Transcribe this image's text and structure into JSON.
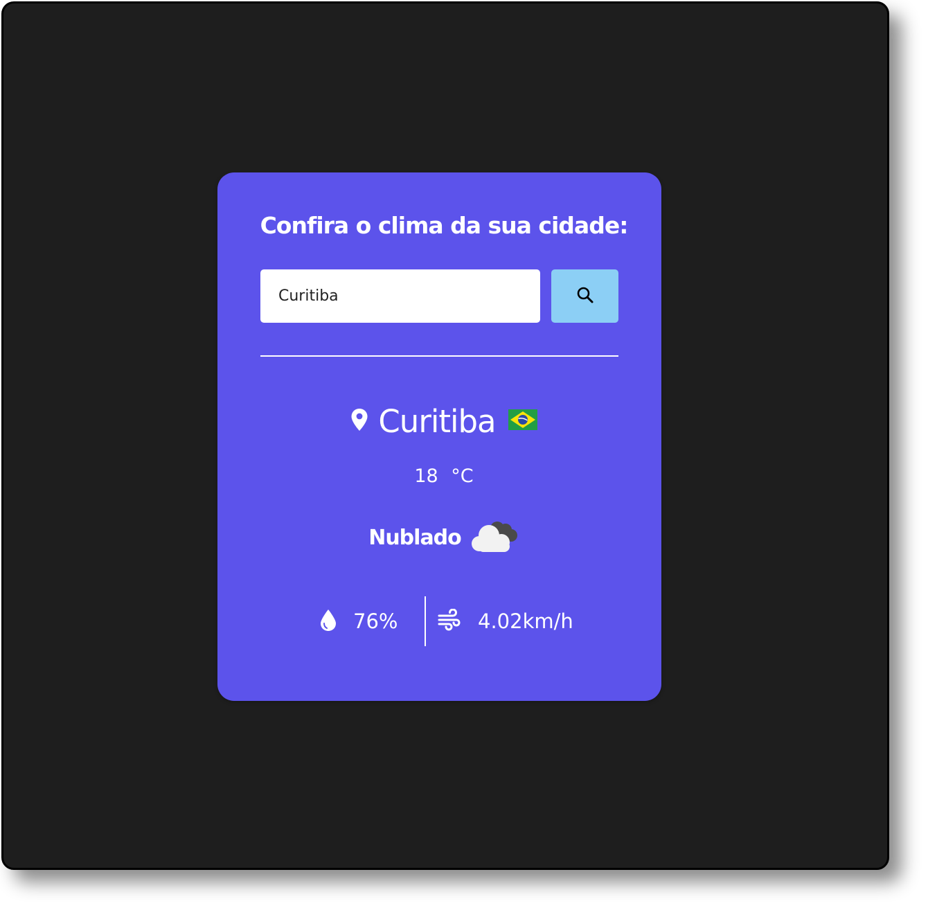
{
  "header": {
    "title": "Confira o clima da sua cidade:"
  },
  "search": {
    "value": "Curitiba",
    "button_icon": "search-icon"
  },
  "weather": {
    "city": "Curitiba",
    "country_flag": "brazil-flag-icon",
    "temperature": "18",
    "unit": "°C",
    "condition": "Nublado",
    "condition_icon": "cloudy-icon",
    "humidity": "76%",
    "wind": "4.02km/h"
  },
  "colors": {
    "background": "#1e1e1e",
    "card": "#5c53eb",
    "button": "#8ccff5",
    "text": "#ffffff"
  }
}
